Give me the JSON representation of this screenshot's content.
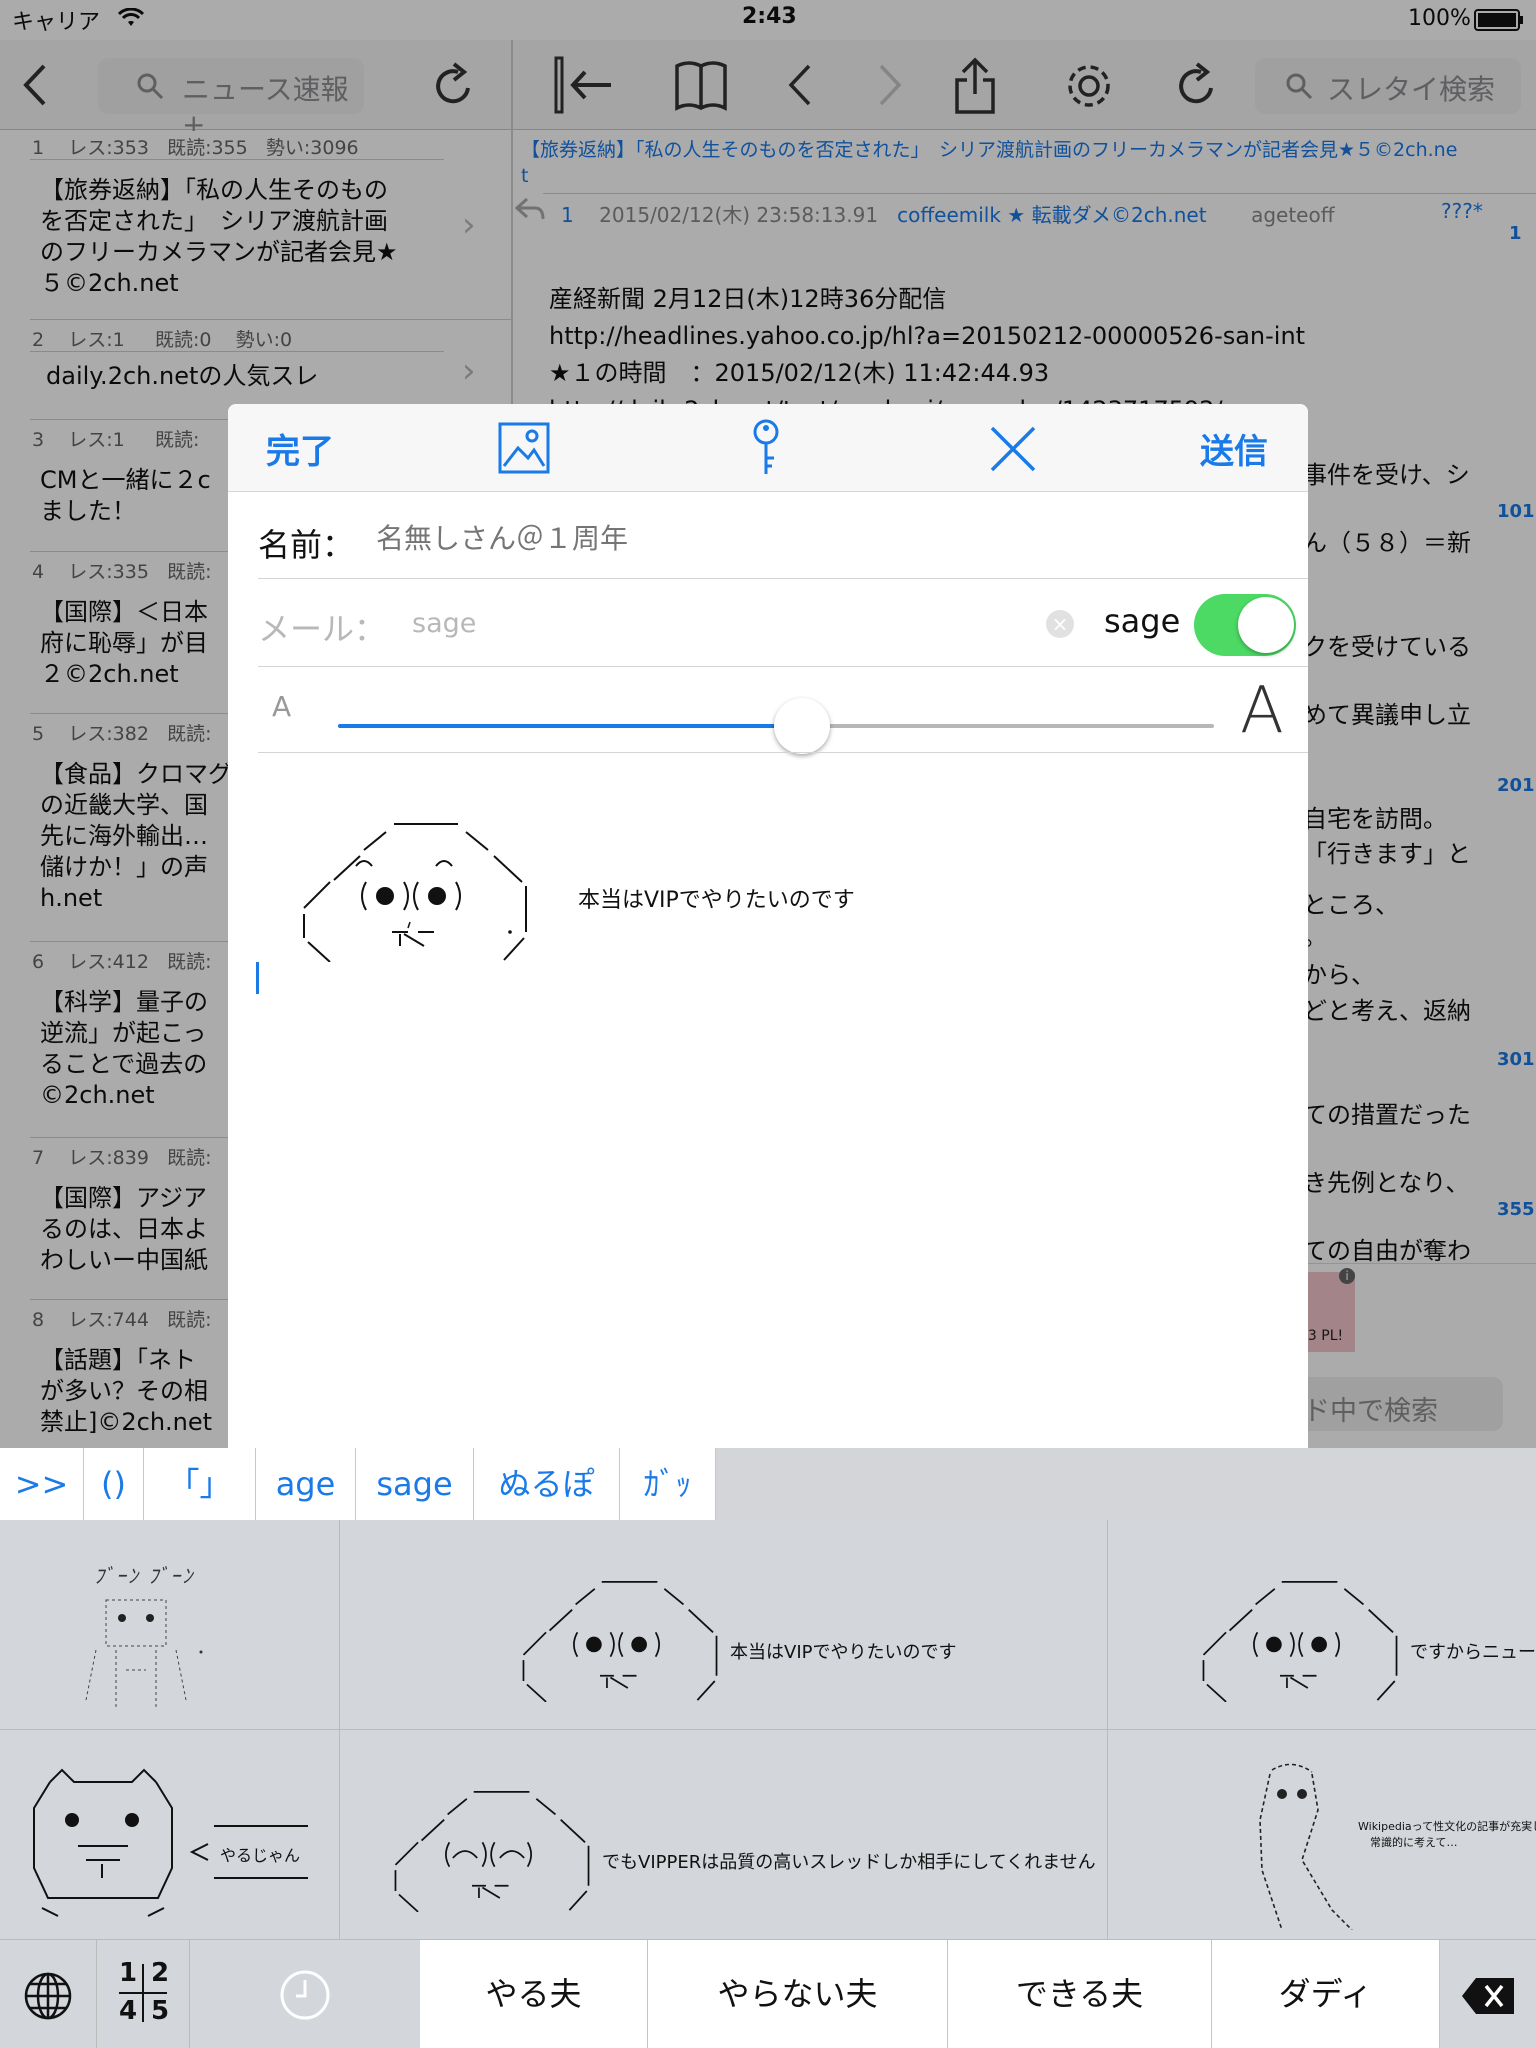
{
  "status_bar": {
    "carrier": "キャリア",
    "time": "2:43",
    "battery": "100%"
  },
  "left_nav": {
    "search_label": "ニュース速報+"
  },
  "right_nav": {
    "search_placeholder": "スレタイ検索"
  },
  "threads": [
    {
      "num": "1",
      "res": "レス:353",
      "read": "既読:355",
      "momentum": "勢い:3096",
      "title_lines": [
        "【旅券返納】「私の人生そのもの",
        "を否定された」　シリア渡航計画",
        "のフリーカメラマンが記者会見★",
        "５©2ch.net"
      ]
    },
    {
      "num": "2",
      "res": "レス:1",
      "read": "既読:0",
      "momentum": "勢い:0",
      "title_lines": [
        "daily.2ch.netの人気スレ"
      ]
    },
    {
      "num": "3",
      "res": "レス:1",
      "read": "既読:",
      "momentum": "",
      "title_lines": [
        "CMと一緒に２c",
        "ました！"
      ]
    },
    {
      "num": "4",
      "res": "レス:335",
      "read": "既読:",
      "momentum": "",
      "title_lines": [
        "【国際】＜日本",
        "府に恥辱」が目",
        "２©2ch.net"
      ]
    },
    {
      "num": "5",
      "res": "レス:382",
      "read": "既読:",
      "momentum": "",
      "title_lines": [
        "【食品】クロマグ",
        "の近畿大学、国",
        "先に海外輸出…",
        "儲けか！」の声",
        "h.net"
      ]
    },
    {
      "num": "6",
      "res": "レス:412",
      "read": "既読:",
      "momentum": "",
      "title_lines": [
        "【科学】量子の",
        "逆流」が起こっ",
        "ることで過去の",
        "©2ch.net"
      ]
    },
    {
      "num": "7",
      "res": "レス:839",
      "read": "既読:",
      "momentum": "",
      "title_lines": [
        "【国際】アジア",
        "るのは、日本よ",
        "わしいー中国紙"
      ]
    },
    {
      "num": "8",
      "res": "レス:744",
      "read": "既読:",
      "momentum": "",
      "title_lines": [
        "【話題】「ネト",
        "が多い？その相",
        "禁止]©2ch.net"
      ]
    }
  ],
  "content": {
    "thread_title_line1": "【旅券返納】「私の人生そのものを否定された」　シリア渡航計画のフリーカメラマンが記者会見★５©2ch.ne",
    "thread_title_line2": "t",
    "post_header": {
      "num": "1",
      "date": "2015/02/12(木) 23:58:13.91",
      "name": "coffeemilk ★ 転載ダメ©2ch.net",
      "id": "ageteoff",
      "misc": "???*",
      "count": "1"
    },
    "body_lines": [
      "産経新聞 2月12日(木)12時36分配信",
      "★１の時間　：2015/02/12(木) 11:42:44.93"
    ],
    "body_link": "http://headlines.yahoo.co.jp/hl?a=20150212-00000526-san-int",
    "partial_link": "http://daily.2ch.net/test/read.cgi/newsplus/1423717592/",
    "right_fragments": [
      "事件を受け、シ",
      "ん（５８）＝新",
      "クを受けている",
      "めて異議申し立",
      "自宅を訪問。",
      "「行きます」と",
      "ところ、",
      "。",
      "から、",
      "どと考え、返納",
      "ての措置だった",
      "き先例となり、",
      "ての自由が奪わ"
    ],
    "right_numbers": [
      "101",
      "201",
      "301",
      "355"
    ],
    "search_in": "ド中で検索",
    "ad_text": "13 PL!"
  },
  "composer": {
    "done": "完了",
    "send": "送信",
    "name_label": "名前：",
    "name_placeholder": "名無しさん＠１周年",
    "mail_label": "メール：",
    "mail_value": "sage",
    "sage_label": "sage",
    "sage_on": true,
    "font_small": "A",
    "font_large": "A",
    "font_slider_level": 0.53,
    "aa_caption": "本当はVIPでやりたいのです"
  },
  "quick_buttons": [
    ">>",
    "()",
    "「」",
    "age",
    "sage",
    "ぬるぽ",
    "ｶﾞｯ"
  ],
  "aa_panel": {
    "caption_1": "本当はVIPでやりたいのです",
    "caption_2": "ですからニュー",
    "caption_3": "やるじゃん",
    "caption_4": "でもVIPPERは品質の高いスレッドしか相手にしてくれません",
    "caption_5a": "Wikipediaって性文化の記事が充実して",
    "caption_5b": "常識的に考えて…",
    "fig_text": "ﾌﾞｰﾝ ﾌﾞｰﾝ"
  },
  "bottom_bar": {
    "page_indicator": [
      "1",
      "2",
      "4",
      "5"
    ],
    "categories": [
      "やる夫",
      "やらない夫",
      "できる夫",
      "ダディ"
    ]
  },
  "colors": {
    "accent": "#1a7ae8",
    "switch_on": "#4cd964"
  }
}
